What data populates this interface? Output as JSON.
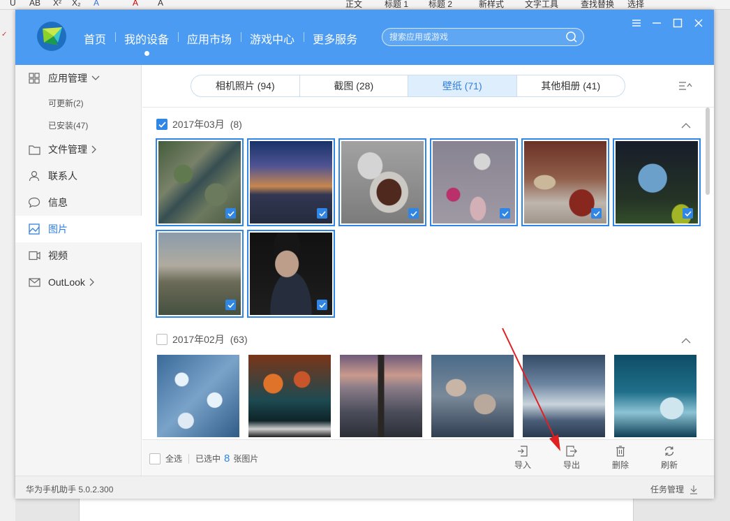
{
  "background_ribbon": {
    "items": [
      "U",
      "AB",
      "X²",
      "X₂",
      "A",
      "A",
      "A",
      "正文",
      "标题 1",
      "标题 2",
      "新样式",
      "文字工具",
      "查找替换",
      "选择"
    ]
  },
  "app": {
    "header": {
      "nav": [
        "首页",
        "我的设备",
        "应用市场",
        "游戏中心",
        "更多服务"
      ],
      "active_nav": "我的设备",
      "search_placeholder": "搜索应用或游戏",
      "accent_color": "#4b9bf2"
    },
    "sidebar": {
      "items": [
        {
          "label": "应用管理",
          "icon": "grid-icon"
        },
        {
          "label": "文件管理",
          "icon": "folder-icon"
        },
        {
          "label": "联系人",
          "icon": "person-icon"
        },
        {
          "label": "信息",
          "icon": "chat-icon"
        },
        {
          "label": "图片",
          "icon": "image-icon"
        },
        {
          "label": "视频",
          "icon": "video-icon"
        },
        {
          "label": "OutLook",
          "icon": "mail-icon"
        }
      ],
      "subitems": [
        "可更新(2)",
        "已安装(47)"
      ],
      "active": "图片"
    },
    "tabs": [
      "相机照片 (94)",
      "截图 (28)",
      "壁纸 (71)",
      "其他相册 (41)"
    ],
    "active_tab": "壁纸 (71)",
    "groups": [
      {
        "date": "2017年03月",
        "count": "(8)",
        "checked": true,
        "selected_images": 8
      },
      {
        "date": "2017年02月",
        "count": "(63)",
        "checked": false
      }
    ],
    "bottom": {
      "select_all": "全选",
      "selected_prefix": "已选中",
      "selected_count": "8",
      "selected_suffix": "张图片",
      "actions": [
        "导入",
        "导出",
        "删除",
        "刷新"
      ]
    },
    "status": {
      "version": "华为手机助手 5.0.2.300",
      "task_manager": "任务管理"
    }
  }
}
